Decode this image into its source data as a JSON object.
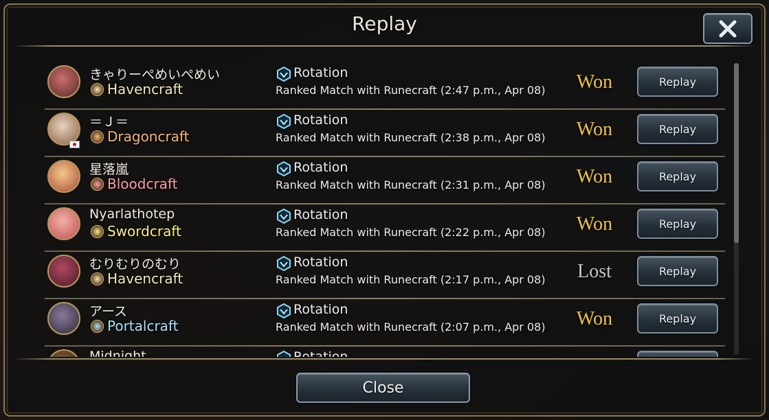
{
  "dialog": {
    "title": "Replay",
    "close_button_label": "Close",
    "close_icon": "close-x-icon"
  },
  "matches": [
    {
      "player": "きゃりーぺめいぺめい",
      "class": "Havencraft",
      "class_color": "#f4e7b8",
      "format": "Rotation",
      "description": "Ranked Match with Runecraft (2:47 p.m., Apr 08)",
      "result": "Won",
      "won": true,
      "replay_label": "Replay",
      "flag": false,
      "avatar_colors": [
        "#c96f6a",
        "#5a2a2a"
      ]
    },
    {
      "player": "＝Ｊ＝",
      "class": "Dragoncraft",
      "class_color": "#f1b77c",
      "format": "Rotation",
      "description": "Ranked Match with Runecraft (2:38 p.m., Apr 08)",
      "result": "Won",
      "won": true,
      "replay_label": "Replay",
      "flag": true,
      "avatar_colors": [
        "#e6d2c0",
        "#8a6040"
      ]
    },
    {
      "player": "星落嵐",
      "class": "Bloodcraft",
      "class_color": "#ff9ea8",
      "format": "Rotation",
      "description": "Ranked Match with Runecraft (2:31 p.m., Apr 08)",
      "result": "Won",
      "won": true,
      "replay_label": "Replay",
      "flag": false,
      "avatar_colors": [
        "#f4c98a",
        "#a84a3a"
      ]
    },
    {
      "player": "Nyarlathotep",
      "class": "Swordcraft",
      "class_color": "#f6ee8a",
      "format": "Rotation",
      "description": "Ranked Match with Runecraft (2:22 p.m., Apr 08)",
      "result": "Won",
      "won": true,
      "replay_label": "Replay",
      "flag": false,
      "avatar_colors": [
        "#f0b0a8",
        "#c05050"
      ]
    },
    {
      "player": "むりむりのむり",
      "class": "Havencraft",
      "class_color": "#f4e7b8",
      "format": "Rotation",
      "description": "Ranked Match with Runecraft (2:17 p.m., Apr 08)",
      "result": "Lost",
      "won": false,
      "replay_label": "Replay",
      "flag": false,
      "avatar_colors": [
        "#b04a60",
        "#4a1a28"
      ]
    },
    {
      "player": "アース",
      "class": "Portalcraft",
      "class_color": "#a8e4ff",
      "format": "Rotation",
      "description": "Ranked Match with Runecraft (2:07 p.m., Apr 08)",
      "result": "Won",
      "won": true,
      "replay_label": "Replay",
      "flag": false,
      "avatar_colors": [
        "#8a7a9a",
        "#2a2a3a"
      ]
    },
    {
      "player": "Midnight",
      "class": "",
      "class_color": "#f4e7b8",
      "format": "Rotation",
      "description": "",
      "result": "",
      "won": true,
      "replay_label": "",
      "flag": false,
      "avatar_colors": [
        "#8a5a3a",
        "#3a2a1a"
      ]
    }
  ]
}
